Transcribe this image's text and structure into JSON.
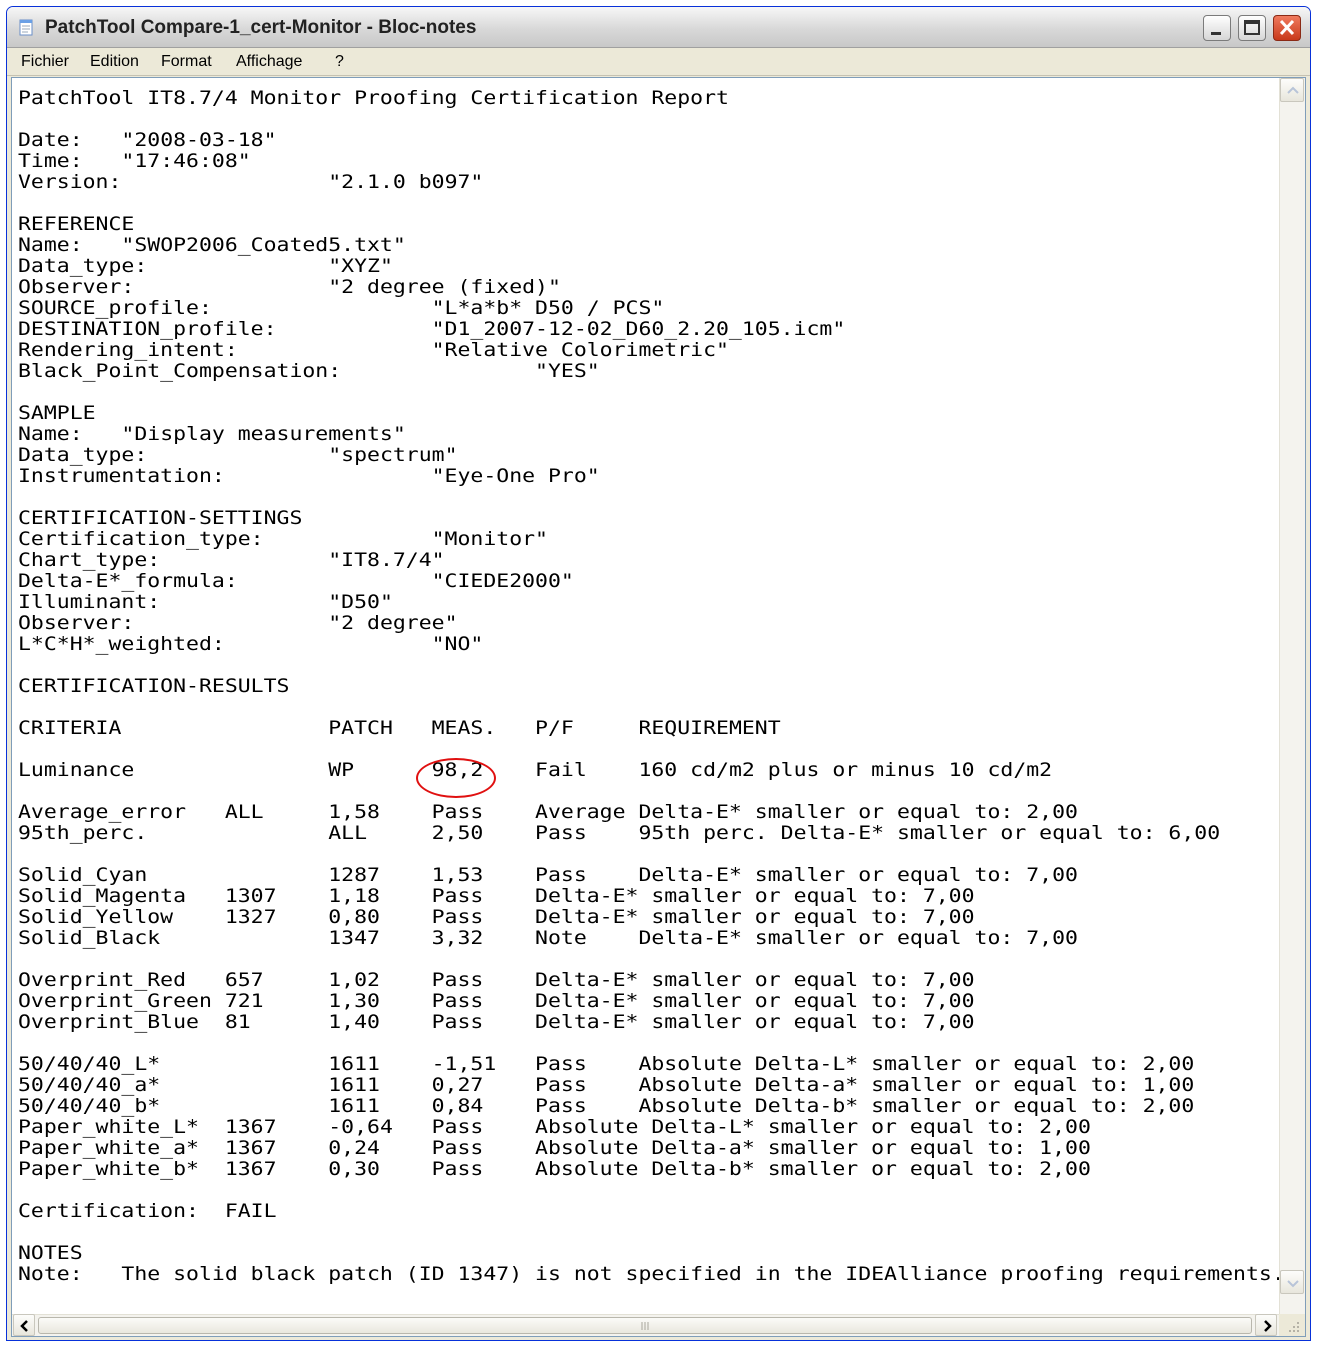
{
  "window": {
    "title": "PatchTool Compare-1_cert-Monitor - Bloc-notes"
  },
  "menu": {
    "file": "Fichier",
    "edit": "Edition",
    "format": "Format",
    "view": "Affichage",
    "help": "?"
  },
  "document": {
    "content": "PatchTool IT8.7/4 Monitor Proofing Certification Report\n\nDate:\t\"2008-03-18\"\nTime:\t\"17:46:08\"\nVersion:\t\t\"2.1.0 b097\"\n\nREFERENCE\nName:\t\"SWOP2006_Coated5.txt\"\nData_type:\t\t\"XYZ\"\nObserver:\t\t\"2 degree (fixed)\"\nSOURCE_profile:\t\t\t\"L*a*b* D50 / PCS\"\nDESTINATION_profile:\t\t\"D1_2007-12-02_D60_2.20_105.icm\"\nRendering_intent:\t\t\"Relative Colorimetric\"\nBlack_Point_Compensation:\t\t\"YES\"\n\nSAMPLE\nName:\t\"Display measurements\"\nData_type:\t\t\"spectrum\"\nInstrumentation:\t\t\"Eye-One Pro\"\n\nCERTIFICATION-SETTINGS\nCertification_type:\t\t\"Monitor\"\nChart_type:\t\t\"IT8.7/4\"\nDelta-E*_formula:\t\t\"CIEDE2000\"\nIlluminant:\t\t\"D50\"\nObserver:\t\t\"2 degree\"\nL*C*H*_weighted:\t\t\"NO\"\n\nCERTIFICATION-RESULTS\n\nCRITERIA\t\tPATCH\tMEAS.\tP/F\tREQUIREMENT\n\nLuminance\t\tWP\t98,2\tFail\t160 cd/m2 plus or minus 10 cd/m2\n\nAverage_error\tALL\t1,58\tPass\tAverage Delta-E* smaller or equal to: 2,00\n95th_perc.\t\tALL\t2,50\tPass\t95th perc. Delta-E* smaller or equal to: 6,00\n\nSolid_Cyan\t\t1287\t1,53\tPass\tDelta-E* smaller or equal to: 7,00\nSolid_Magenta\t1307\t1,18\tPass\tDelta-E* smaller or equal to: 7,00\nSolid_Yellow\t1327\t0,80\tPass\tDelta-E* smaller or equal to: 7,00\nSolid_Black\t\t1347\t3,32\tNote\tDelta-E* smaller or equal to: 7,00\n\nOverprint_Red\t657\t1,02\tPass\tDelta-E* smaller or equal to: 7,00\nOverprint_Green\t721\t1,30\tPass\tDelta-E* smaller or equal to: 7,00\nOverprint_Blue\t81\t1,40\tPass\tDelta-E* smaller or equal to: 7,00\n\n50/40/40_L*\t\t1611\t-1,51\tPass\tAbsolute Delta-L* smaller or equal to: 2,00\n50/40/40_a*\t\t1611\t0,27\tPass\tAbsolute Delta-a* smaller or equal to: 1,00\n50/40/40_b*\t\t1611\t0,84\tPass\tAbsolute Delta-b* smaller or equal to: 2,00\nPaper_white_L*\t1367\t-0,64\tPass\tAbsolute Delta-L* smaller or equal to: 2,00\nPaper_white_a*\t1367\t0,24\tPass\tAbsolute Delta-a* smaller or equal to: 1,00\nPaper_white_b*\t1367\t0,30\tPass\tAbsolute Delta-b* smaller or equal to: 2,00\n\nCertification:\tFAIL\n\nNOTES\nNote:\tThe solid black patch (ID 1347) is not specified in the IDEAlliance proofing requirements."
  },
  "colors": {
    "highlight_ring": "#e01010"
  }
}
